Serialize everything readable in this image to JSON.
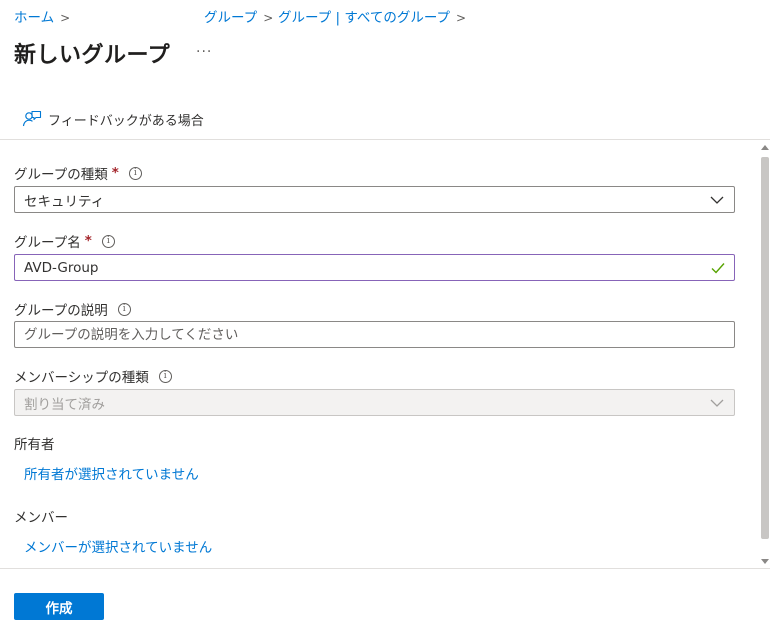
{
  "breadcrumb": {
    "home": "ホーム",
    "groups": "グループ",
    "all_groups": "グループ | すべてのグループ",
    "separator": ">"
  },
  "page": {
    "title": "新しいグループ",
    "more": "..."
  },
  "toolbar": {
    "feedback_label": "フィードバックがある場合",
    "feedback_icon": "feedback-person-icon"
  },
  "form": {
    "group_type": {
      "label": "グループの種類",
      "required": "*",
      "info": "i",
      "value": "セキュリティ"
    },
    "group_name": {
      "label": "グループ名",
      "required": "*",
      "info": "i",
      "value": "AVD-Group"
    },
    "group_description": {
      "label": "グループの説明",
      "info": "i",
      "placeholder": "グループの説明を入力してください"
    },
    "membership_type": {
      "label": "メンバーシップの種類",
      "info": "i",
      "value": "割り当て済み"
    },
    "owners": {
      "label": "所有者",
      "link": "所有者が選択されていません"
    },
    "members": {
      "label": "メンバー",
      "link": "メンバーが選択されていません"
    }
  },
  "footer": {
    "create_label": "作成"
  },
  "colors": {
    "accent": "#0078d4",
    "required": "#a4262c",
    "valid_border": "#8764b8",
    "valid_check": "#57a300"
  }
}
